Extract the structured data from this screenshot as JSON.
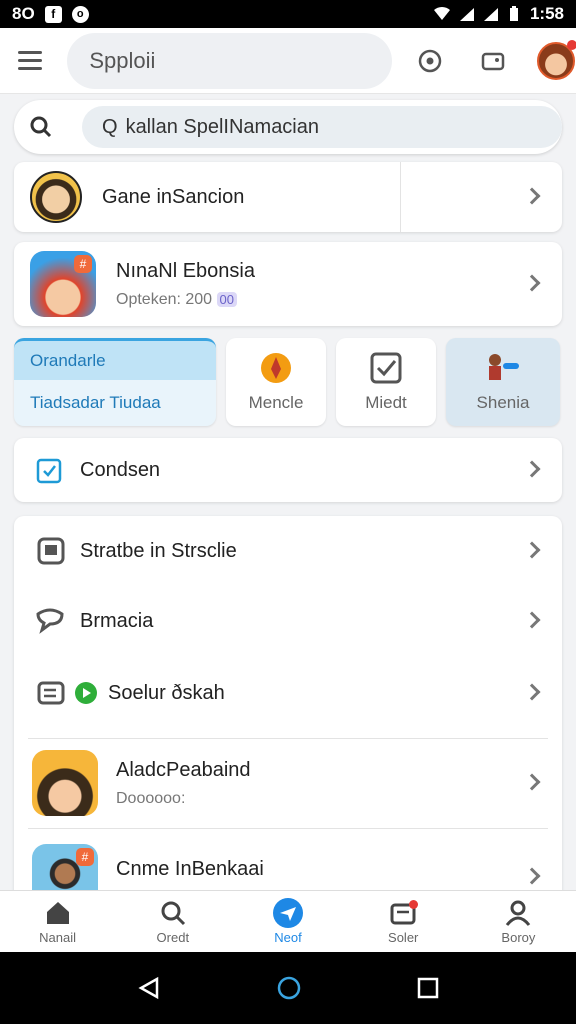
{
  "status_bar": {
    "left_text": "8O",
    "time": "1:58"
  },
  "app_bar": {
    "search_text": "Spploii"
  },
  "search": {
    "value": "kallan SpelINamacian",
    "prefix": "Q"
  },
  "game_card": {
    "title": "Gane inSancion"
  },
  "app_card": {
    "title": "NınaNl Ebonsia",
    "subtitle": "Opteken: 200",
    "tag": "00"
  },
  "tiles": [
    {
      "label": "Orandarle",
      "sub": "Tiadsadar Tiudaa"
    },
    {
      "label": "Mencle"
    },
    {
      "label": "Miedt"
    },
    {
      "label": "Shenia"
    }
  ],
  "condsen": {
    "title": "Condsen"
  },
  "list": [
    {
      "title": "Stratbe in Strsclie",
      "icon": "square-icon"
    },
    {
      "title": "Brmacia",
      "icon": "chat-bubble-icon"
    },
    {
      "title": "Soelur ðskah",
      "icon": "play-icon"
    },
    {
      "title": "AladcPeabaind",
      "subtitle": "Doooooo:",
      "icon": "game-avatar-icon"
    },
    {
      "title": "Cnme InBenkaai",
      "icon": "person-avatar-icon"
    }
  ],
  "bottom_nav": [
    {
      "label": "Nanail",
      "icon": "home-icon"
    },
    {
      "label": "Oredt",
      "icon": "search-icon"
    },
    {
      "label": "Neof",
      "icon": "plane-icon"
    },
    {
      "label": "Soler",
      "icon": "inbox-icon"
    },
    {
      "label": "Boroy",
      "icon": "person-icon"
    }
  ],
  "colors": {
    "accent": "#1e88e5",
    "app_bar_bg": "#ffffff",
    "page_bg": "#f2f3f5"
  }
}
